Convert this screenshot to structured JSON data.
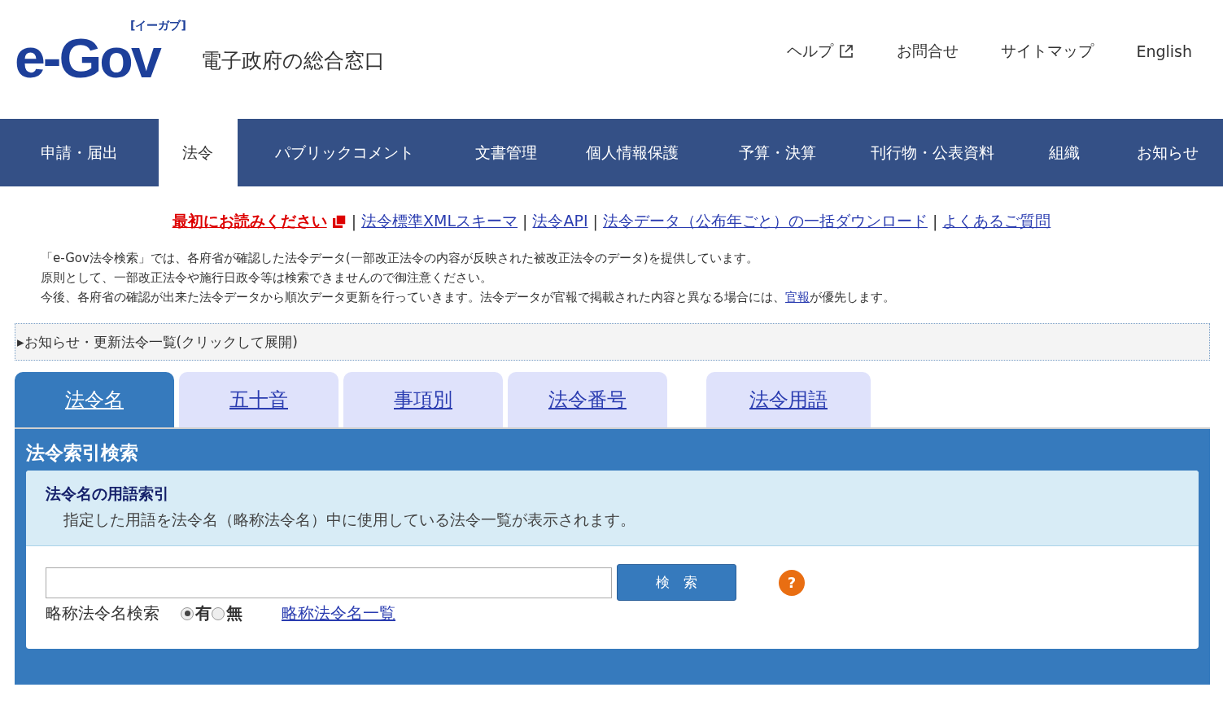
{
  "header": {
    "logo": {
      "wordmark": "e-Gov",
      "reading": "[イーガブ]"
    },
    "tagline": "電子政府の総合窓口",
    "links": [
      {
        "label": "ヘルプ",
        "external": true
      },
      {
        "label": "お問合せ",
        "external": false
      },
      {
        "label": "サイトマップ",
        "external": false
      },
      {
        "label": "English",
        "external": false
      }
    ]
  },
  "nav": [
    {
      "label": "申請・届出",
      "selected": false
    },
    {
      "label": "法令",
      "selected": true
    },
    {
      "label": "パブリックコメント",
      "selected": false
    },
    {
      "label": "文書管理",
      "selected": false
    },
    {
      "label": "個人情報保護",
      "selected": false
    },
    {
      "label": "予算・決算",
      "selected": false
    },
    {
      "label": "刊行物・公表資料",
      "selected": false
    },
    {
      "label": "組織",
      "selected": false
    },
    {
      "label": "お知らせ",
      "selected": false
    }
  ],
  "quick_links": [
    {
      "label": "最初にお読みください",
      "kind": "notice"
    },
    {
      "label": "法令標準XMLスキーマ",
      "kind": "link"
    },
    {
      "label": "法令API",
      "kind": "link"
    },
    {
      "label": "法令データ（公布年ごと）の一括ダウンロード",
      "kind": "link"
    },
    {
      "label": "よくあるご質問",
      "kind": "link"
    }
  ],
  "separator": "|",
  "notes": [
    {
      "text": "「e-Gov法令検索」では、各府省が確認した法令データ(一部改正法令の内容が反映された被改正法令のデータ)を提供しています。"
    },
    {
      "text": "原則として、一部改正法令や施行日政令等は検索できませんので御注意ください。"
    },
    {
      "text": "今後、各府省の確認が出来た法令データから順次データ更新を行っていきます。法令データが官報で掲載された内容と異なる場合には、",
      "link": "官報",
      "after": "が優先します。"
    }
  ],
  "expander": {
    "marker": "▸",
    "label": "お知らせ・更新法令一覧(クリックして展開)",
    "expanded": false
  },
  "tabs": [
    {
      "label": "法令名",
      "selected": true
    },
    {
      "label": "五十音",
      "selected": false
    },
    {
      "label": "事項別",
      "selected": false
    },
    {
      "label": "法令番号",
      "selected": false
    },
    {
      "label": "法令用語",
      "selected": false
    }
  ],
  "panel": {
    "title": "法令索引検索",
    "card": {
      "heading": "法令名の用語索引",
      "description": "指定した用語を法令名（略称法令名）中に使用している法令一覧が表示されます。",
      "search_button": "検　索",
      "help": "?",
      "option_label": "略称法令名検索",
      "options": [
        {
          "label": "有",
          "selected": true
        },
        {
          "label": "無",
          "selected": false
        }
      ],
      "list_link": "略称法令名一覧"
    }
  }
}
